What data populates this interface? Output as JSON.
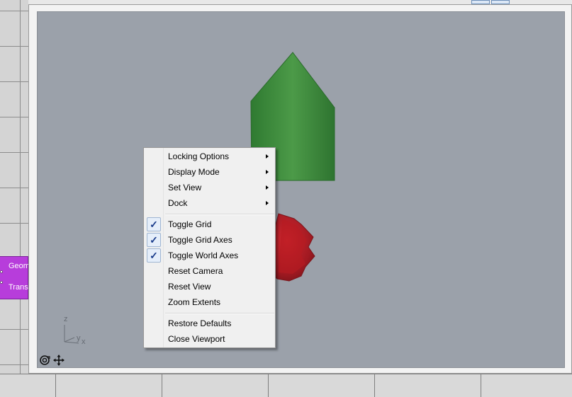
{
  "canvas": {
    "component": {
      "inputs": [
        "Geom",
        "Trans"
      ]
    }
  },
  "viewport": {
    "axes": {
      "z": "z",
      "y": "y",
      "x": "x"
    },
    "colors": {
      "background": "#9ba1aa",
      "green_shape": "#3e8a3c",
      "red_shape": "#a8131b"
    },
    "tools": [
      "orbit-icon",
      "pan-icon"
    ]
  },
  "context_menu": {
    "items": [
      {
        "label": "Locking Options",
        "submenu": true,
        "checked": false
      },
      {
        "label": "Display Mode",
        "submenu": true,
        "checked": false
      },
      {
        "label": "Set View",
        "submenu": true,
        "checked": false
      },
      {
        "label": "Dock",
        "submenu": true,
        "checked": false
      },
      {
        "label": "Toggle Grid",
        "submenu": false,
        "checked": true
      },
      {
        "label": "Toggle Grid Axes",
        "submenu": false,
        "checked": true
      },
      {
        "label": "Toggle World Axes",
        "submenu": false,
        "checked": true
      },
      {
        "label": "Reset Camera",
        "submenu": false,
        "checked": false
      },
      {
        "label": "Reset View",
        "submenu": false,
        "checked": false
      },
      {
        "label": "Zoom Extents",
        "submenu": false,
        "checked": false
      },
      {
        "label": "Restore Defaults",
        "submenu": false,
        "checked": false
      },
      {
        "label": "Close Viewport",
        "submenu": false,
        "checked": false
      }
    ],
    "check_glyph": "✓"
  }
}
